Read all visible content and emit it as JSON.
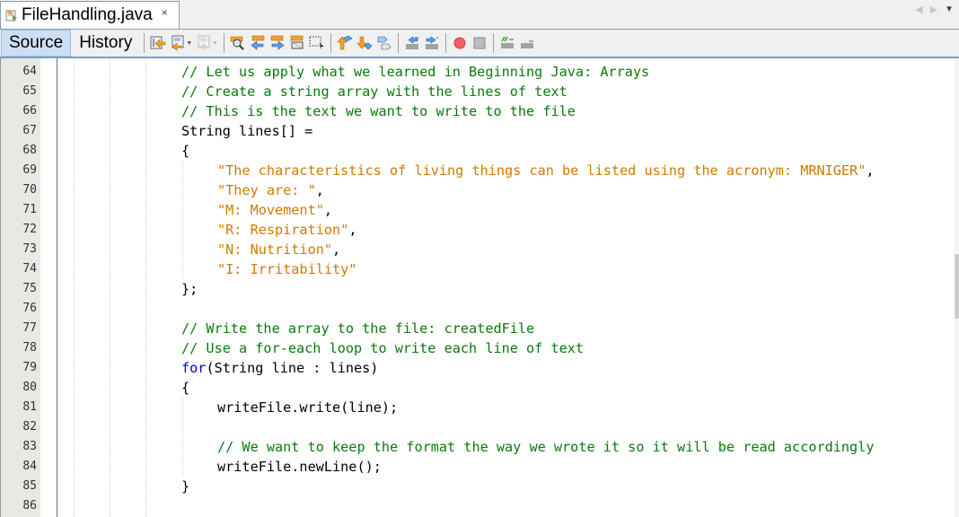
{
  "tab": {
    "title": "FileHandling.java",
    "close_glyph": "×",
    "icon": "java-file-icon"
  },
  "tab_nav": {
    "prev_glyph": "◀",
    "next_glyph": "▶",
    "menu_glyph": "▼"
  },
  "toolbar": {
    "source_label": "Source",
    "history_label": "History",
    "buttons": [
      {
        "name": "last-edit-icon",
        "label": "Last Edit"
      },
      {
        "name": "back-icon",
        "label": "Back"
      },
      {
        "name": "forward-icon",
        "label": "Forward"
      },
      {
        "name": "find-selection-icon",
        "label": "Find Selection"
      },
      {
        "name": "find-previous-icon",
        "label": "Find Previous"
      },
      {
        "name": "find-next-icon",
        "label": "Find Next"
      },
      {
        "name": "toggle-highlight-icon",
        "label": "Toggle Highlight Search"
      },
      {
        "name": "toggle-rect-select-icon",
        "label": "Toggle Rectangular Selection"
      },
      {
        "name": "previous-bookmark-icon",
        "label": "Previous Bookmark"
      },
      {
        "name": "next-bookmark-icon",
        "label": "Next Bookmark"
      },
      {
        "name": "toggle-bookmark-icon",
        "label": "Toggle Bookmark"
      },
      {
        "name": "shift-left-icon",
        "label": "Shift Line Left"
      },
      {
        "name": "shift-right-icon",
        "label": "Shift Line Right"
      },
      {
        "name": "start-macro-icon",
        "label": "Start Macro Recording"
      },
      {
        "name": "stop-macro-icon",
        "label": "Stop Macro Recording"
      },
      {
        "name": "comment-icon",
        "label": "Comment"
      },
      {
        "name": "uncomment-icon",
        "label": "Uncomment"
      }
    ]
  },
  "editor": {
    "lines": [
      {
        "num": "64",
        "indent": 1,
        "segments": [
          {
            "t": "comment",
            "v": "// Let us apply what we learned in Beginning Java: Arrays"
          }
        ]
      },
      {
        "num": "65",
        "indent": 1,
        "segments": [
          {
            "t": "comment",
            "v": "// Create a string array with the lines of text"
          }
        ]
      },
      {
        "num": "66",
        "indent": 1,
        "segments": [
          {
            "t": "comment",
            "v": "// This is the text we want to write to the file"
          }
        ]
      },
      {
        "num": "67",
        "indent": 1,
        "segments": [
          {
            "t": "plain",
            "v": "String lines[] ="
          }
        ]
      },
      {
        "num": "68",
        "indent": 1,
        "segments": [
          {
            "t": "plain",
            "v": "{"
          }
        ]
      },
      {
        "num": "69",
        "indent": 2,
        "segments": [
          {
            "t": "string",
            "v": "\"The characteristics of living things can be listed using the acronym: MRNIGER\""
          },
          {
            "t": "plain",
            "v": ","
          }
        ]
      },
      {
        "num": "70",
        "indent": 2,
        "segments": [
          {
            "t": "string",
            "v": "\"They are: \""
          },
          {
            "t": "plain",
            "v": ","
          }
        ]
      },
      {
        "num": "71",
        "indent": 2,
        "segments": [
          {
            "t": "string",
            "v": "\"M: Movement\""
          },
          {
            "t": "plain",
            "v": ","
          }
        ]
      },
      {
        "num": "72",
        "indent": 2,
        "segments": [
          {
            "t": "string",
            "v": "\"R: Respiration\""
          },
          {
            "t": "plain",
            "v": ","
          }
        ]
      },
      {
        "num": "73",
        "indent": 2,
        "segments": [
          {
            "t": "string",
            "v": "\"N: Nutrition\""
          },
          {
            "t": "plain",
            "v": ","
          }
        ]
      },
      {
        "num": "74",
        "indent": 2,
        "segments": [
          {
            "t": "string",
            "v": "\"I: Irritability\""
          }
        ]
      },
      {
        "num": "75",
        "indent": 1,
        "segments": [
          {
            "t": "plain",
            "v": "};"
          }
        ]
      },
      {
        "num": "76",
        "indent": 1,
        "segments": []
      },
      {
        "num": "77",
        "indent": 1,
        "segments": [
          {
            "t": "comment",
            "v": "// Write the array to the file: createdFile"
          }
        ]
      },
      {
        "num": "78",
        "indent": 1,
        "segments": [
          {
            "t": "comment",
            "v": "// Use a for-each loop to write each line of text"
          }
        ]
      },
      {
        "num": "79",
        "indent": 1,
        "segments": [
          {
            "t": "keyword",
            "v": "for"
          },
          {
            "t": "plain",
            "v": "(String line : lines)"
          }
        ]
      },
      {
        "num": "80",
        "indent": 1,
        "segments": [
          {
            "t": "plain",
            "v": "{"
          }
        ]
      },
      {
        "num": "81",
        "indent": 2,
        "segments": [
          {
            "t": "plain",
            "v": "writeFile.write(line);"
          }
        ]
      },
      {
        "num": "82",
        "indent": 2,
        "segments": []
      },
      {
        "num": "83",
        "indent": 2,
        "segments": [
          {
            "t": "comment",
            "v": "// We want to keep the format the way we wrote it so it will be read accordingly"
          }
        ]
      },
      {
        "num": "84",
        "indent": 2,
        "segments": [
          {
            "t": "plain",
            "v": "writeFile.newLine();"
          }
        ]
      },
      {
        "num": "85",
        "indent": 1,
        "segments": [
          {
            "t": "plain",
            "v": "}"
          }
        ]
      },
      {
        "num": "86",
        "indent": 1,
        "segments": []
      }
    ]
  }
}
